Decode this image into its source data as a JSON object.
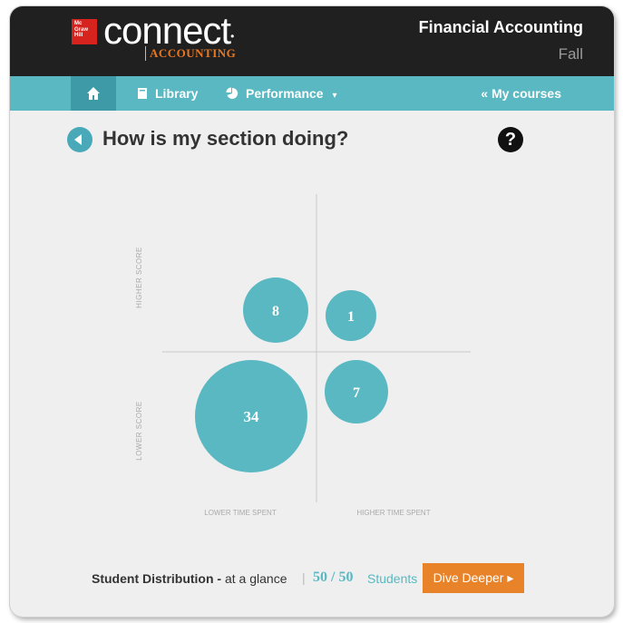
{
  "header": {
    "logo_box_text": "Mc\nGraw\nHill\nEducation",
    "logo_word": "connect",
    "logo_sub": "ACCOUNTING",
    "course_title": "Financial Accounting",
    "course_term": "Fall"
  },
  "nav": {
    "home_icon": "home-icon",
    "library": "Library",
    "performance": "Performance",
    "my_courses": "« My courses"
  },
  "page": {
    "title": "How is my section doing?",
    "help": "?"
  },
  "chart_data": {
    "type": "scatter",
    "title": "",
    "quadrant_labels": {
      "y_high": "HIGHER SCORE",
      "y_low": "LOWER SCORE",
      "x_low": "LOWER TIME SPENT",
      "x_high": "HIGHER TIME SPENT"
    },
    "bubbles": [
      {
        "quadrant": "lower-time-higher-score",
        "count": 8
      },
      {
        "quadrant": "higher-time-higher-score",
        "count": 1
      },
      {
        "quadrant": "lower-time-lower-score",
        "count": 34
      },
      {
        "quadrant": "higher-time-lower-score",
        "count": 7
      }
    ],
    "colors": {
      "bubble": "#5ab8c2",
      "axis": "#c8c8c8"
    }
  },
  "footer": {
    "label_bold": "Student Distribution -",
    "label_rest": " at a glance",
    "separator": "|",
    "count": "50 / 50",
    "students": "Students",
    "dive_button": "Dive Deeper ▸"
  },
  "colors": {
    "topbar": "#202020",
    "accent": "#5ab8c2",
    "button": "#e8832a",
    "brand_red": "#d6231e"
  }
}
